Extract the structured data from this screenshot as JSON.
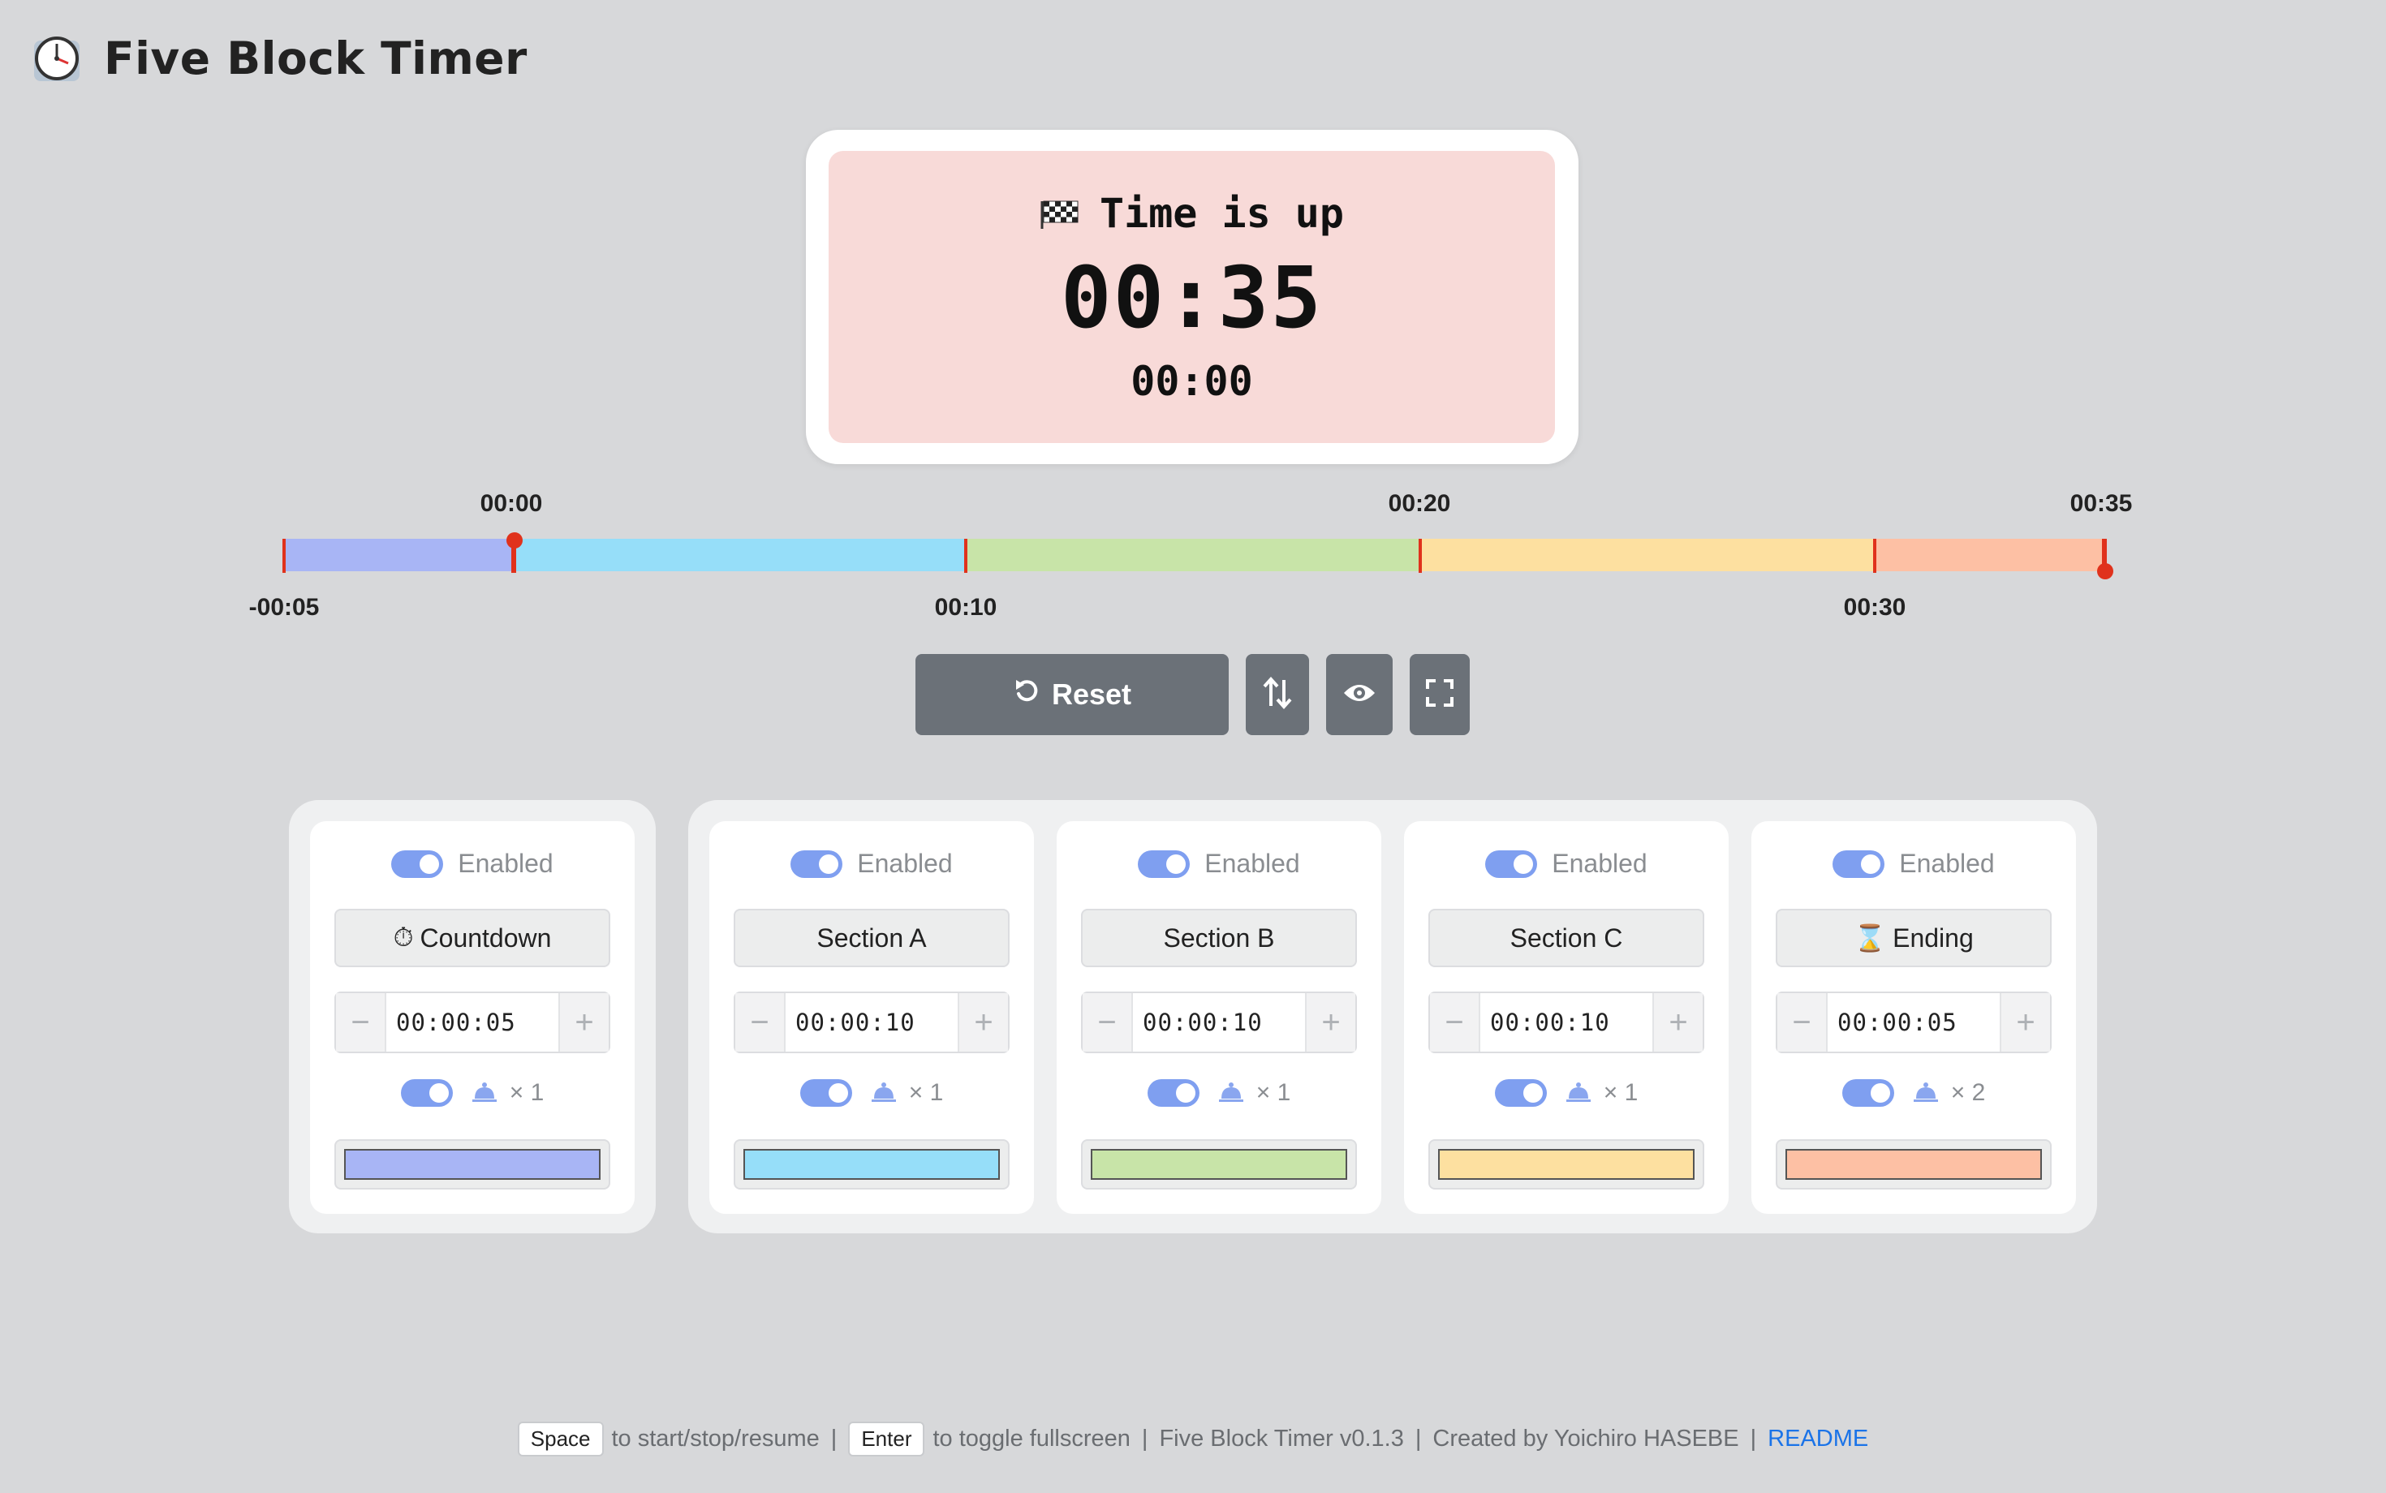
{
  "app": {
    "title": "Five Block Timer"
  },
  "display": {
    "status": "Time is up",
    "status_icon": "checkered-flag-icon",
    "main_time": "00:35",
    "sub_time": "00:00",
    "background": "#f8dad8"
  },
  "timeline": {
    "labels_top": [
      "00:00",
      "00:20",
      "00:35"
    ],
    "labels_bottom": [
      "-00:05",
      "00:10",
      "00:30"
    ],
    "segment_colors": [
      "#a8b5f5",
      "#96def9",
      "#c8e4a8",
      "#fde0a0",
      "#fdc0a4"
    ],
    "progress_fraction": 1.0
  },
  "controls": {
    "reset_label": "Reset",
    "icons": [
      "reset-icon",
      "swap-vertical-icon",
      "eye-icon",
      "fullscreen-icon"
    ]
  },
  "blocks": [
    {
      "enabled_label": "Enabled",
      "name_icon": "⏱",
      "name": "Countdown",
      "duration": "00:00:05",
      "chime_count": "× 1",
      "color": "#a8b5f5"
    },
    {
      "enabled_label": "Enabled",
      "name_icon": "",
      "name": "Section A",
      "duration": "00:00:10",
      "chime_count": "× 1",
      "color": "#96def9"
    },
    {
      "enabled_label": "Enabled",
      "name_icon": "",
      "name": "Section B",
      "duration": "00:00:10",
      "chime_count": "× 1",
      "color": "#c8e4a8"
    },
    {
      "enabled_label": "Enabled",
      "name_icon": "",
      "name": "Section C",
      "duration": "00:00:10",
      "chime_count": "× 1",
      "color": "#fde0a0"
    },
    {
      "enabled_label": "Enabled",
      "name_icon": "⌛",
      "name": "Ending",
      "duration": "00:00:05",
      "chime_count": "× 2",
      "color": "#fdc0a4"
    }
  ],
  "stepper": {
    "minus": "−",
    "plus": "+"
  },
  "footer": {
    "space_key": "Space",
    "space_text": "to start/stop/resume",
    "enter_key": "Enter",
    "enter_text": "to toggle fullscreen",
    "version": "Five Block Timer v0.1.3",
    "credit": "Created by Yoichiro HASEBE",
    "sep": "|",
    "readme": "README"
  }
}
